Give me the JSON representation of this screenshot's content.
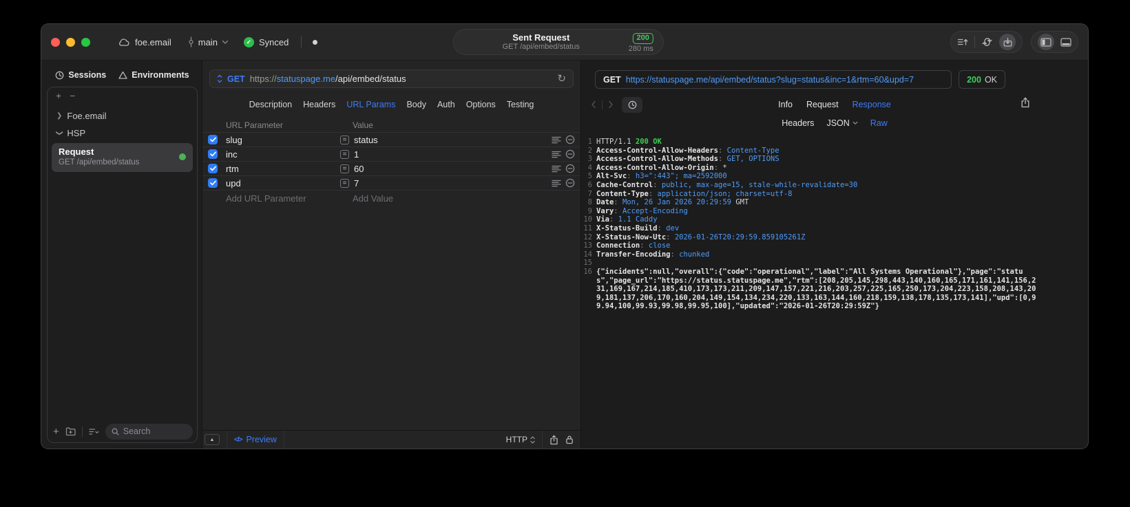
{
  "colors": {
    "accent": "#3d7bfa",
    "code-blue": "#4f9cf8",
    "code-green": "#3fce53",
    "badge-green": "#3ecf56",
    "checkbox-blue": "#2f7cf6",
    "dot-green": "#4db354",
    "sync-green": "#2dbd4e",
    "traffic-red": "#ff5f57",
    "traffic-yellow": "#febc2e",
    "traffic-green": "#28c840"
  },
  "titlebar": {
    "project": "foe.email",
    "branch": "main",
    "sync_label": "Synced",
    "request_title": "Sent Request",
    "request_subtitle": "GET /api/embed/status",
    "status_code": "200",
    "duration": "280 ms"
  },
  "sidebar": {
    "tabs": [
      {
        "label": "Sessions"
      },
      {
        "label": "Environments"
      }
    ],
    "active_tab": "Sessions",
    "groups": [
      {
        "label": "Foe.email",
        "state": "collapsed"
      },
      {
        "label": "HSP",
        "state": "expanded"
      }
    ],
    "request_item": {
      "title": "Request",
      "subtitle": "GET /api/embed/status"
    },
    "search_placeholder": "Search"
  },
  "request_editor": {
    "method": "GET",
    "url": {
      "scheme": "https://",
      "host": "statuspage.me",
      "path": "/api/embed/status"
    },
    "tabs": [
      "Description",
      "Headers",
      "URL Params",
      "Body",
      "Auth",
      "Options",
      "Testing"
    ],
    "active_tab": "URL Params",
    "params": {
      "columns": [
        "URL Parameter",
        "Value"
      ],
      "rows": [
        {
          "enabled": true,
          "name": "slug",
          "value": "status"
        },
        {
          "enabled": true,
          "name": "inc",
          "value": "1"
        },
        {
          "enabled": true,
          "name": "rtm",
          "value": "60"
        },
        {
          "enabled": true,
          "name": "upd",
          "value": "7"
        }
      ],
      "add_name_placeholder": "Add URL Parameter",
      "add_value_placeholder": "Add Value"
    },
    "footer": {
      "preview_label": "Preview",
      "protocol": "HTTP"
    }
  },
  "response_viewer": {
    "method": "GET",
    "url": "https://statuspage.me/api/embed/status?slug=status&inc=1&rtm=60&upd=7",
    "status_code": "200",
    "status_text": "OK",
    "tabs": [
      "Info",
      "Request",
      "Response"
    ],
    "active_tab": "Response",
    "subtabs": [
      {
        "label": "Headers"
      },
      {
        "label": "JSON",
        "has_menu": true
      },
      {
        "label": "Raw"
      }
    ],
    "active_subtab": "Raw",
    "lines": [
      {
        "n": 1,
        "segs": [
          {
            "t": "HTTP/1.1 ",
            "c": "fg"
          },
          {
            "t": "200 OK",
            "c": "green"
          }
        ]
      },
      {
        "n": 2,
        "segs": [
          {
            "t": "Access-Control-Allow-Headers",
            "c": "key"
          },
          {
            "t": ": ",
            "c": "dim"
          },
          {
            "t": "Content-Type",
            "c": "blue"
          }
        ]
      },
      {
        "n": 3,
        "segs": [
          {
            "t": "Access-Control-Allow-Methods",
            "c": "key"
          },
          {
            "t": ": ",
            "c": "dim"
          },
          {
            "t": "GET, OPTIONS",
            "c": "blue"
          }
        ]
      },
      {
        "n": 4,
        "segs": [
          {
            "t": "Access-Control-Allow-Origin",
            "c": "key"
          },
          {
            "t": ": ",
            "c": "dim"
          },
          {
            "t": "*",
            "c": "fg"
          }
        ]
      },
      {
        "n": 5,
        "segs": [
          {
            "t": "Alt-Svc",
            "c": "key"
          },
          {
            "t": ": ",
            "c": "dim"
          },
          {
            "t": "h3=\":443\"; ma=2592000",
            "c": "blue"
          }
        ]
      },
      {
        "n": 6,
        "segs": [
          {
            "t": "Cache-Control",
            "c": "key"
          },
          {
            "t": ": ",
            "c": "dim"
          },
          {
            "t": "public, max-age=15, stale-while-revalidate=30",
            "c": "blue"
          }
        ]
      },
      {
        "n": 7,
        "segs": [
          {
            "t": "Content-Type",
            "c": "key"
          },
          {
            "t": ": ",
            "c": "dim"
          },
          {
            "t": "application/json; charset=utf-8",
            "c": "blue"
          }
        ]
      },
      {
        "n": 8,
        "segs": [
          {
            "t": "Date",
            "c": "key"
          },
          {
            "t": ": ",
            "c": "dim"
          },
          {
            "t": "Mon, 26 Jan 2026 20:29:59",
            "c": "blue"
          },
          {
            "t": " GMT",
            "c": "fg"
          }
        ]
      },
      {
        "n": 9,
        "segs": [
          {
            "t": "Vary",
            "c": "key"
          },
          {
            "t": ": ",
            "c": "dim"
          },
          {
            "t": "Accept-Encoding",
            "c": "blue"
          }
        ]
      },
      {
        "n": 10,
        "segs": [
          {
            "t": "Via",
            "c": "key"
          },
          {
            "t": ": ",
            "c": "dim"
          },
          {
            "t": "1.1 Caddy",
            "c": "blue"
          }
        ]
      },
      {
        "n": 11,
        "segs": [
          {
            "t": "X-Status-Build",
            "c": "key"
          },
          {
            "t": ": ",
            "c": "dim"
          },
          {
            "t": "dev",
            "c": "blue"
          }
        ]
      },
      {
        "n": 12,
        "segs": [
          {
            "t": "X-Status-Now-Utc",
            "c": "key"
          },
          {
            "t": ": ",
            "c": "dim"
          },
          {
            "t": "2026-01-26T20:29:59.859105261Z",
            "c": "blue"
          }
        ]
      },
      {
        "n": 13,
        "segs": [
          {
            "t": "Connection",
            "c": "key"
          },
          {
            "t": ": ",
            "c": "dim"
          },
          {
            "t": "close",
            "c": "blue"
          }
        ]
      },
      {
        "n": 14,
        "segs": [
          {
            "t": "Transfer-Encoding",
            "c": "key"
          },
          {
            "t": ": ",
            "c": "dim"
          },
          {
            "t": "chunked",
            "c": "blue"
          }
        ]
      },
      {
        "n": 15,
        "segs": []
      },
      {
        "n": 16,
        "segs": [
          {
            "t": "{\"incidents\":null,\"overall\":{\"code\":\"operational\",\"label\":\"All Systems Operational\"},\"page\":\"status\",\"page_url\":\"https://status.statuspage.me\",\"rtm\":[208,205,145,298,443,140,160,165,171,161,141,156,231,169,167,214,185,410,173,173,211,209,147,157,221,216,203,257,225,165,250,173,204,223,158,208,143,209,181,137,206,170,160,204,149,154,134,234,220,133,163,144,160,218,159,138,178,135,173,141],\"upd\":[0,99.94,100,99.93,99.98,99.95,100],\"updated\":\"2026-01-26T20:29:59Z\"}",
            "c": "key"
          }
        ]
      }
    ]
  }
}
